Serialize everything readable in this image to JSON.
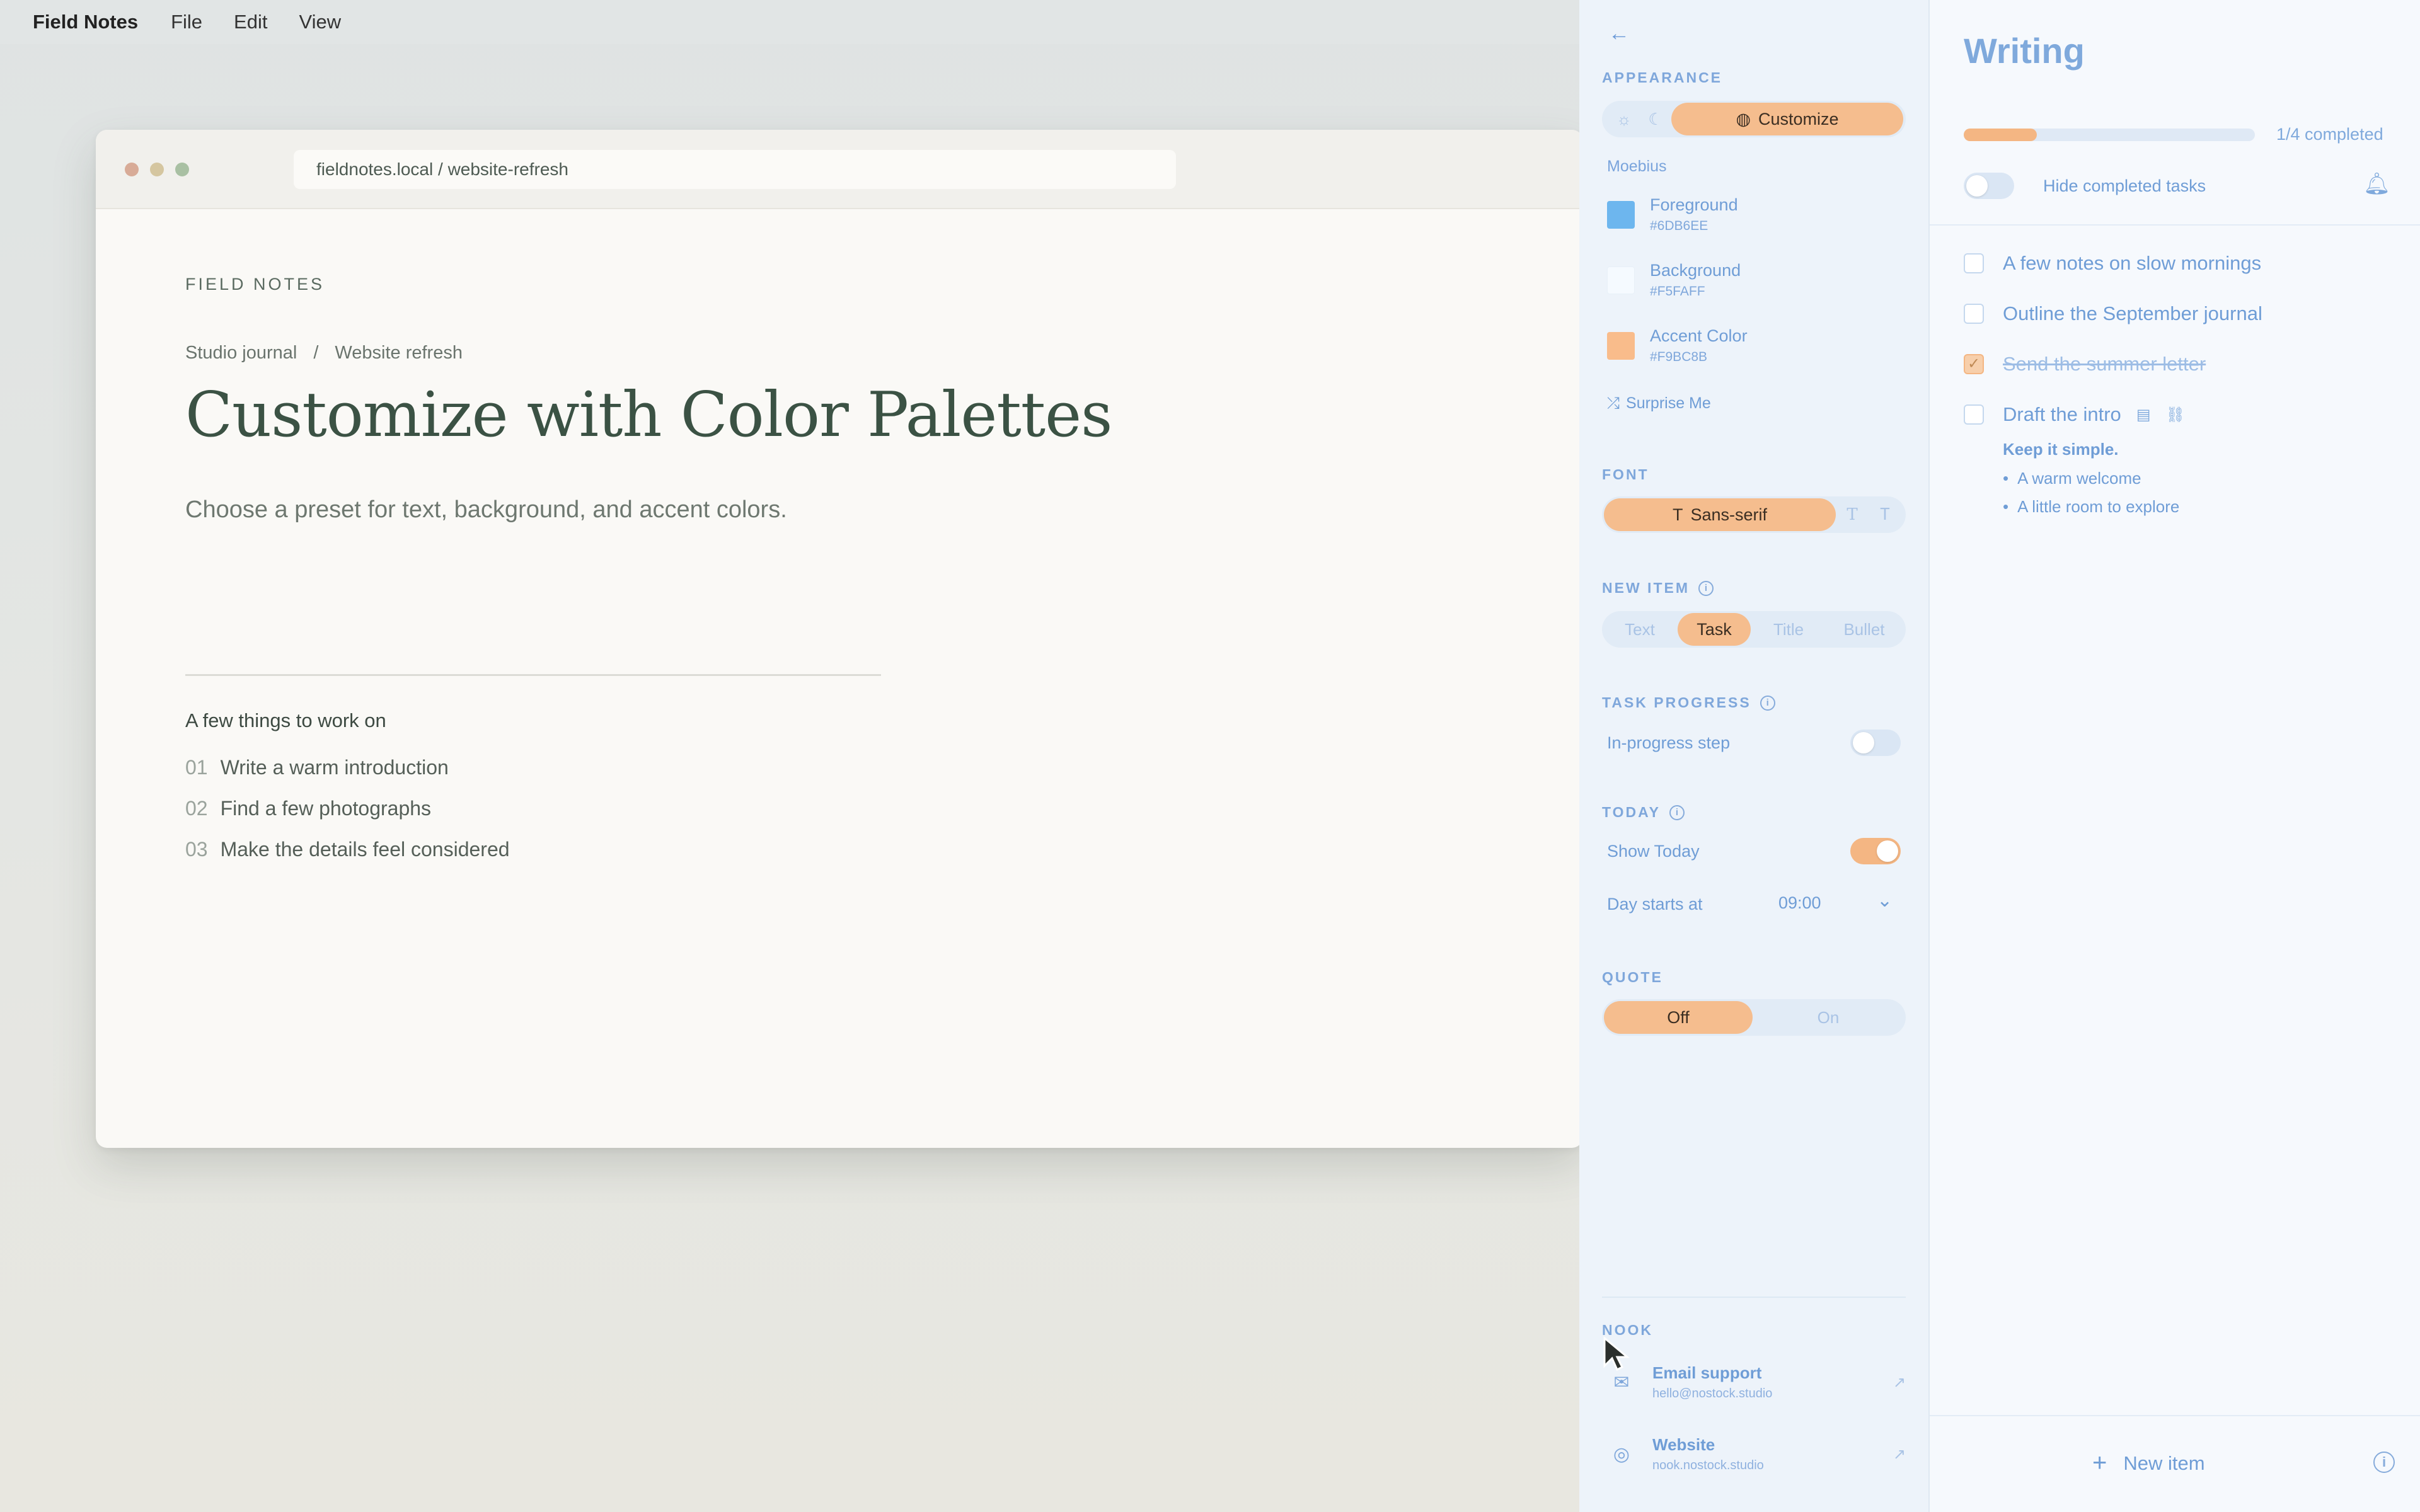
{
  "menubar": {
    "app": "Field Notes",
    "items": [
      "File",
      "Edit",
      "View"
    ]
  },
  "browser": {
    "address": "fieldnotes.local / website-refresh",
    "traffic_colors": [
      "#d8ab97",
      "#d5c6a0",
      "#a9c0a3"
    ]
  },
  "page": {
    "eyebrow": "FIELD NOTES",
    "breadcrumb": [
      "Studio journal",
      "/",
      "Website refresh"
    ],
    "headline": "Customize with Color Palettes",
    "subhead": "Choose a preset for text, background, and accent colors.",
    "list_title": "A few things to work on",
    "items": [
      {
        "num": "01",
        "text": "Write a warm introduction"
      },
      {
        "num": "02",
        "text": "Find a few photographs"
      },
      {
        "num": "03",
        "text": "Make the details feel considered"
      }
    ]
  },
  "settings": {
    "appearance": {
      "label": "APPEARANCE",
      "options": [
        "light-icon",
        "dark-icon"
      ],
      "active_label": "Customize",
      "palette_name": "Moebius",
      "swatches": [
        {
          "name": "Foreground",
          "hex": "#6DB6EE",
          "color": "#6DB6EE"
        },
        {
          "name": "Background",
          "hex": "#F5FAFF",
          "color": "#F5FAFF"
        },
        {
          "name": "Accent Color",
          "hex": "#F9BC8B",
          "color": "#F9BC8B"
        }
      ],
      "surprise": "Surprise Me"
    },
    "font": {
      "label": "FONT",
      "active": "Sans-serif",
      "alt_options": [
        "serif-icon",
        "mono-icon"
      ]
    },
    "new_item": {
      "label": "NEW ITEM",
      "options": [
        "Text",
        "Task",
        "Title",
        "Bullet"
      ],
      "active": "Task"
    },
    "task_progress": {
      "label": "TASK PROGRESS",
      "row": "In-progress step",
      "enabled": false
    },
    "today": {
      "label": "TODAY",
      "show_label": "Show Today",
      "show_enabled": true,
      "day_starts_label": "Day starts at",
      "day_starts_value": "09:00"
    },
    "quote": {
      "label": "QUOTE",
      "options": [
        "Off",
        "On"
      ],
      "active": "Off"
    },
    "nook": {
      "label": "NOOK",
      "links": [
        {
          "title": "Email support",
          "detail": "hello@nostock.studio"
        },
        {
          "title": "Website",
          "detail": "nook.nostock.studio"
        }
      ]
    }
  },
  "writing": {
    "title": "Writing",
    "progress": 0.25,
    "progress_text": "1/4 completed",
    "hide_label": "Hide completed tasks",
    "hide_enabled": false,
    "tasks": [
      {
        "text": "A few notes on slow mornings",
        "done": false
      },
      {
        "text": "Outline the September journal",
        "done": false
      },
      {
        "text": "Send the summer letter",
        "done": true
      },
      {
        "text": "Draft the intro",
        "done": false
      }
    ],
    "note": "Keep it simple.",
    "bullets": [
      "A warm welcome",
      "A little room to explore"
    ],
    "new_item": "New item"
  }
}
